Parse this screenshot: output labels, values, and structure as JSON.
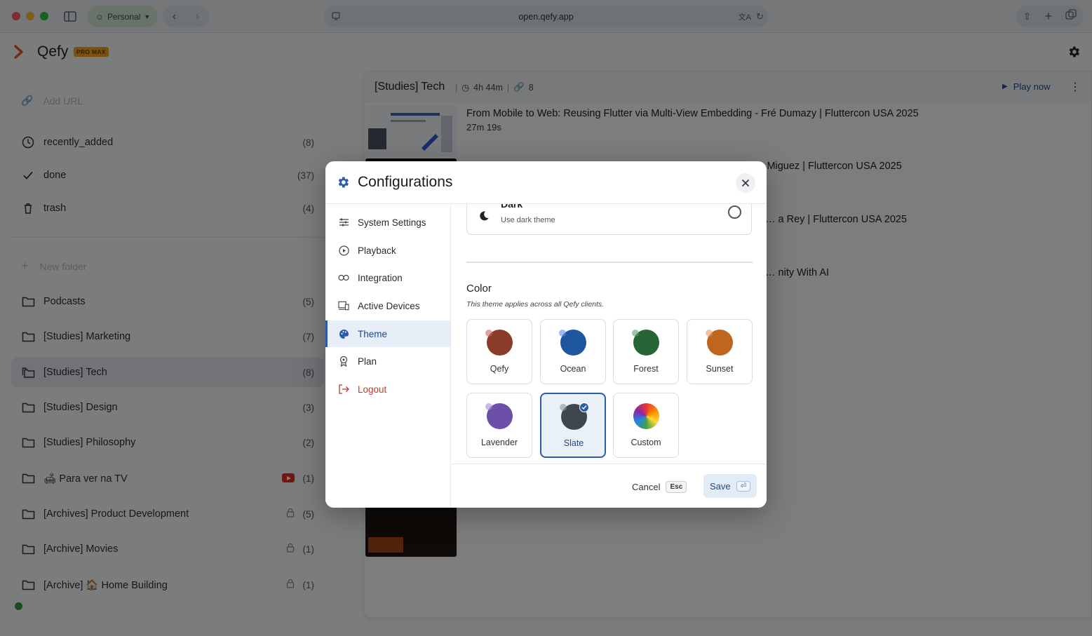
{
  "browser": {
    "profile_label": "Personal",
    "url": "open.qefy.app"
  },
  "app": {
    "title": "Qefy",
    "badge": "PRO MAX"
  },
  "sidebar": {
    "add_url_placeholder": "Add URL",
    "new_folder_label": "New folder",
    "smart_items": [
      {
        "label": "recently_added",
        "count": "(8)",
        "icon": "clock-icon"
      },
      {
        "label": "done",
        "count": "(37)",
        "icon": "check-icon"
      },
      {
        "label": "trash",
        "count": "(4)",
        "icon": "trash-icon"
      }
    ],
    "folders": [
      {
        "label": "Podcasts",
        "count": "(5)"
      },
      {
        "label": "[Studies] Marketing",
        "count": "(7)"
      },
      {
        "label": "[Studies] Tech",
        "count": "(8)"
      },
      {
        "label": "[Studies] Design",
        "count": "(3)"
      },
      {
        "label": "[Studies] Philosophy",
        "count": "(2)"
      },
      {
        "label": "🛋 Para ver na TV",
        "count": "(1)"
      },
      {
        "label": "[Archives] Product Development",
        "count": "(5)"
      },
      {
        "label": "[Archive] Movies",
        "count": "(1)"
      },
      {
        "label": "[Archive] 🏠 Home Building",
        "count": "(1)"
      }
    ]
  },
  "panel": {
    "title": "[Studies] Tech",
    "duration": "4h 44m",
    "link_count": "8",
    "play_label": "Play now",
    "videos": [
      {
        "title": "From Mobile to Web: Reusing Flutter via Multi-View Embedding - Fré Dumazy | Fluttercon USA 2025",
        "duration": "27m 19s"
      },
      {
        "title": "Mastering Scalable Theming for Custom Flutter Widgets - Marcelo Miguez | Fluttercon USA 2025",
        "duration": ""
      },
      {
        "title": "… a Rey | Fluttercon USA 2025",
        "duration": ""
      },
      {
        "title": "… nity With AI",
        "duration": ""
      }
    ]
  },
  "modal": {
    "title": "Configurations",
    "nav": [
      {
        "label": "System Settings",
        "icon": "sliders-icon"
      },
      {
        "label": "Playback",
        "icon": "play-circle-icon"
      },
      {
        "label": "Integration",
        "icon": "link-icon"
      },
      {
        "label": "Active Devices",
        "icon": "devices-icon"
      },
      {
        "label": "Theme",
        "icon": "palette-icon"
      },
      {
        "label": "Plan",
        "icon": "award-icon"
      },
      {
        "label": "Logout",
        "icon": "logout-icon"
      }
    ],
    "dark_option": {
      "title": "Dark",
      "subtitle": "Use dark theme"
    },
    "color_section": {
      "title": "Color",
      "subtitle": "This theme applies across all Qefy clients.",
      "selected": "Slate",
      "swatches": [
        {
          "label": "Qefy",
          "color": "#8a3b2a"
        },
        {
          "label": "Ocean",
          "color": "#1e56a0"
        },
        {
          "label": "Forest",
          "color": "#276436"
        },
        {
          "label": "Sunset",
          "color": "#c0651d"
        },
        {
          "label": "Lavender",
          "color": "#6b4fa8"
        },
        {
          "label": "Slate",
          "color": "#3f4650"
        },
        {
          "label": "Custom",
          "color": "conic"
        }
      ]
    },
    "cancel_label": "Cancel",
    "cancel_key": "Esc",
    "save_label": "Save",
    "save_key": "⏎"
  }
}
